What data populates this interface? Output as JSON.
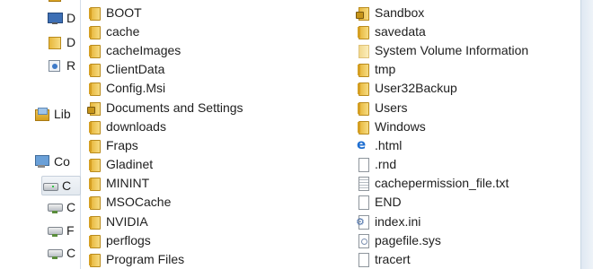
{
  "navigation": {
    "items": [
      {
        "label": "",
        "icon": "libraries-icon"
      },
      {
        "label": "D",
        "icon": "desktop-icon"
      },
      {
        "label": "D",
        "icon": "folder-icon"
      },
      {
        "label": "R",
        "icon": "recent-places-icon"
      },
      {
        "label": "Lib",
        "icon": "libraries-icon"
      },
      {
        "label": "Co",
        "icon": "computer-icon"
      },
      {
        "label": "C",
        "icon": "drive-icon",
        "selected": true
      },
      {
        "label": "C",
        "icon": "network-drive-icon"
      },
      {
        "label": "F",
        "icon": "network-drive-icon"
      },
      {
        "label": "C",
        "icon": "network-drive-icon"
      }
    ]
  },
  "files": {
    "column1": [
      {
        "name": "BOOT",
        "icon": "folder-icon"
      },
      {
        "name": "cache",
        "icon": "folder-icon"
      },
      {
        "name": "cacheImages",
        "icon": "folder-icon"
      },
      {
        "name": "ClientData",
        "icon": "folder-icon"
      },
      {
        "name": "Config.Msi",
        "icon": "folder-icon"
      },
      {
        "name": "Documents and Settings",
        "icon": "locked-folder-icon"
      },
      {
        "name": "downloads",
        "icon": "folder-icon"
      },
      {
        "name": "Fraps",
        "icon": "folder-icon"
      },
      {
        "name": "Gladinet",
        "icon": "folder-icon"
      },
      {
        "name": "MININT",
        "icon": "folder-icon"
      },
      {
        "name": "MSOCache",
        "icon": "folder-icon"
      },
      {
        "name": "NVIDIA",
        "icon": "folder-icon"
      },
      {
        "name": "perflogs",
        "icon": "folder-icon"
      },
      {
        "name": "Program Files",
        "icon": "folder-icon"
      }
    ],
    "column2": [
      {
        "name": "Sandbox",
        "icon": "locked-folder-icon"
      },
      {
        "name": "savedata",
        "icon": "folder-icon"
      },
      {
        "name": "System Volume Information",
        "icon": "hidden-folder-icon"
      },
      {
        "name": "tmp",
        "icon": "folder-icon"
      },
      {
        "name": "User32Backup",
        "icon": "folder-icon"
      },
      {
        "name": "Users",
        "icon": "folder-icon"
      },
      {
        "name": "Windows",
        "icon": "folder-icon"
      },
      {
        "name": ".html",
        "icon": "html-file-icon"
      },
      {
        "name": ".rnd",
        "icon": "blank-file-icon"
      },
      {
        "name": "cachepermission_file.txt",
        "icon": "text-file-icon"
      },
      {
        "name": "END",
        "icon": "blank-file-icon"
      },
      {
        "name": "index.ini",
        "icon": "settings-file-icon"
      },
      {
        "name": "pagefile.sys",
        "icon": "system-file-icon"
      },
      {
        "name": "tracert",
        "icon": "blank-file-icon"
      }
    ]
  }
}
